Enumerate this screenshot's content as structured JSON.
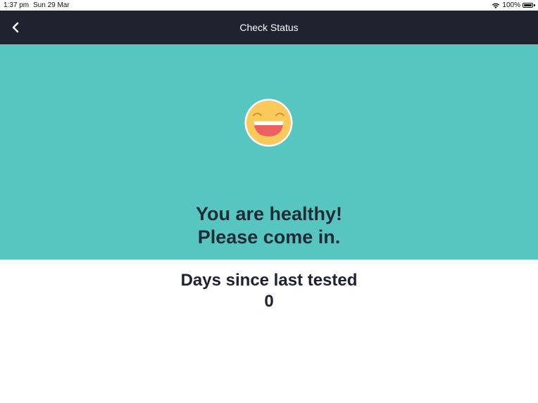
{
  "status_bar": {
    "time": "1:37 pm",
    "date": "Sun 29 Mar",
    "battery": "100%",
    "icons": [
      "wifi-icon",
      "battery-icon"
    ]
  },
  "nav": {
    "title": "Check Status",
    "back_icon": "chevron-left-icon"
  },
  "hero": {
    "emoji": "laughing-face-icon",
    "line1": "You are healthy!",
    "line2": "Please come in.",
    "background_color": "#58c6c0"
  },
  "days": {
    "label": "Days since last tested",
    "value": "0"
  },
  "colors": {
    "nav_background": "#20232f",
    "text_dark": "#1f2b36"
  }
}
